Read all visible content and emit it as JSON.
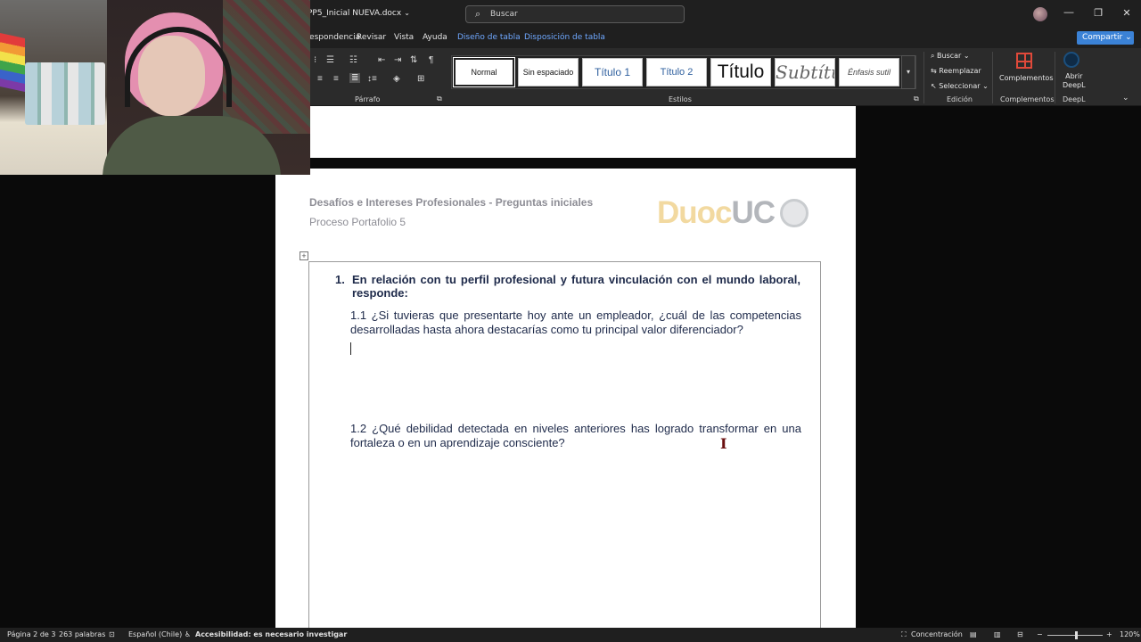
{
  "titlebar": {
    "doc_title": "PP5_Inicial NUEVA.docx",
    "search_placeholder": "Buscar"
  },
  "tabs": [
    "rrespondencia",
    "Revisar",
    "Vista",
    "Ayuda",
    "Diseño de tabla",
    "Disposición de tabla"
  ],
  "share_label": "Compartir",
  "ribbon": {
    "parrafo_label": "Párrafo",
    "estilos_label": "Estilos",
    "edicion_label": "Edición",
    "complementos_label": "Complementos",
    "deepl_label": "DeepL",
    "styles": [
      "Normal",
      "Sin espaciado",
      "Título 1",
      "Título 2",
      "Título",
      "Subtítulo",
      "Énfasis sutil"
    ],
    "edit_items": [
      "Buscar",
      "Reemplazar",
      "Seleccionar"
    ],
    "complementos_btn": "Complementos",
    "deepl_btn_line1": "Abrir",
    "deepl_btn_line2": "DeepL"
  },
  "document": {
    "header_title": "Desafíos e Intereses Profesionales - Preguntas iniciales",
    "header_subtitle": "Proceso Portafolio 5",
    "logo_part1": "Duoc",
    "logo_part2": "UC",
    "q1_number": "1.",
    "q1_text": "En relación con tu perfil profesional y futura vinculación con el mundo laboral, responde:",
    "q1_1": "1.1 ¿Si tuvieras que presentarte hoy ante un empleador, ¿cuál de las competencias desarrolladas hasta ahora destacarías como tu principal valor diferenciador?",
    "q1_2": "1.2 ¿Qué debilidad detectada en niveles anteriores has logrado transformar en una fortaleza o en un aprendizaje consciente?"
  },
  "statusbar": {
    "page": "Página 2 de 3",
    "words": "263 palabras",
    "language": "Español (Chile)",
    "accessibility": "Accesibilidad: es necesario investigar",
    "focus": "Concentración",
    "zoom": "120%"
  },
  "colors": {
    "accent": "#3b82d6",
    "contextual_tab": "#6fa8ff",
    "question_text": "#1e2a4a"
  }
}
